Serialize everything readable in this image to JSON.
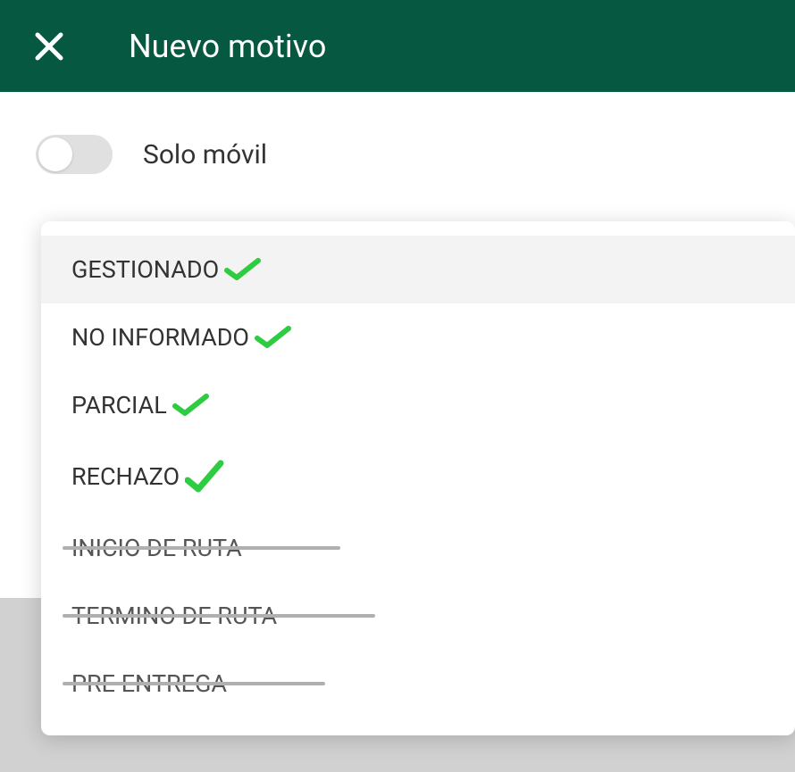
{
  "header": {
    "title": "Nuevo motivo"
  },
  "toggle": {
    "label": "Solo móvil",
    "enabled": false
  },
  "colors": {
    "header_bg": "#075840",
    "check_green": "#2ecc40"
  },
  "dropdown": {
    "items": [
      {
        "label": "GESTIONADO",
        "checked": true,
        "disabled": false,
        "highlighted": true
      },
      {
        "label": "NO INFORMADO",
        "checked": true,
        "disabled": false,
        "highlighted": false
      },
      {
        "label": "PARCIAL",
        "checked": true,
        "disabled": false,
        "highlighted": false
      },
      {
        "label": "RECHAZO",
        "checked": true,
        "disabled": false,
        "highlighted": false
      },
      {
        "label": "INICIO DE RUTA",
        "checked": false,
        "disabled": true,
        "highlighted": false
      },
      {
        "label": "TERMINO DE RUTA",
        "checked": false,
        "disabled": true,
        "highlighted": false
      },
      {
        "label": "PRE ENTREGA",
        "checked": false,
        "disabled": true,
        "highlighted": false
      }
    ]
  }
}
